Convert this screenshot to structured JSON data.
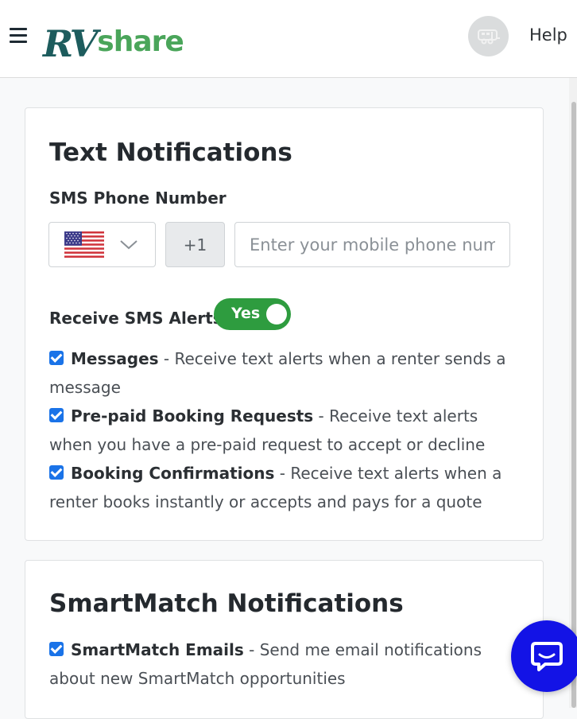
{
  "header": {
    "logo_rv": "RV",
    "logo_share": "share",
    "help_label": "Help"
  },
  "text_notifications": {
    "title": "Text Notifications",
    "sms_label": "SMS Phone Number",
    "country_code": "+1",
    "phone_placeholder": "Enter your mobile phone number",
    "phone_value": "",
    "receive_label": "Receive SMS Alerts",
    "toggle_label": "Yes",
    "options": [
      {
        "title": "Messages",
        "desc": " - Receive text alerts when a renter sends a message"
      },
      {
        "title": "Pre-paid Booking Requests",
        "desc": " - Receive text alerts when you have a pre-paid request to accept or decline"
      },
      {
        "title": "Booking Confirmations",
        "desc": " - Receive text alerts when a renter books instantly or accepts and pays for a quote"
      }
    ]
  },
  "smartmatch": {
    "title": "SmartMatch Notifications",
    "options": [
      {
        "title": "SmartMatch Emails",
        "desc": " - Send me email notifications about new SmartMatch opportunities"
      }
    ]
  },
  "colors": {
    "logo_rv": "#1d5c5d",
    "logo_share": "#4aa55a",
    "toggle_on": "#2e9c3f",
    "checkbox": "#1a73e8",
    "chat": "#1313e6"
  },
  "icons": {
    "menu": "hamburger-menu-icon",
    "avatar": "rv-trailer-icon",
    "flag": "us-flag-icon",
    "chevron": "chevron-down-icon",
    "chat": "chat-bubble-icon"
  }
}
